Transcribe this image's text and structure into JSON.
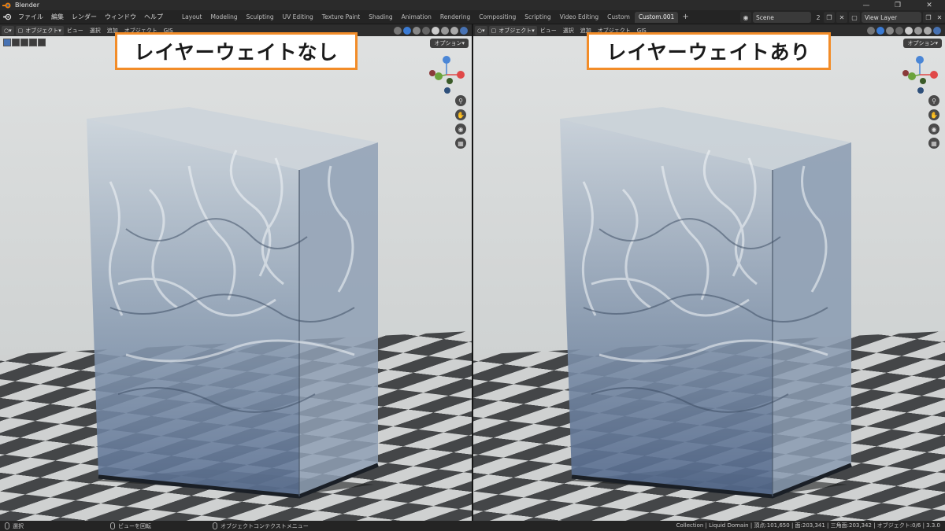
{
  "window": {
    "title": "Blender"
  },
  "menu": [
    "ファイル",
    "編集",
    "レンダー",
    "ウィンドウ",
    "ヘルプ"
  ],
  "workspaces": [
    "Layout",
    "Modeling",
    "Sculpting",
    "UV Editing",
    "Texture Paint",
    "Shading",
    "Animation",
    "Rendering",
    "Compositing",
    "Scripting",
    "Video Editing",
    "Custom",
    "Custom.001"
  ],
  "active_workspace": "Custom.001",
  "scene": {
    "name": "Scene",
    "count": "2"
  },
  "view_layer": {
    "name": "View Layer"
  },
  "viewport_left": {
    "mode": "オブジェクト",
    "menus": [
      "ビュー",
      "選択",
      "追加",
      "オブジェクト",
      "GIS"
    ],
    "options": "オプション",
    "label": "レイヤーウェイトなし"
  },
  "viewport_right": {
    "mode": "オブジェクト",
    "menus": [
      "ビュー",
      "選択",
      "追加",
      "オブジェクト",
      "GIS"
    ],
    "options": "オプション",
    "label": "レイヤーウェイトあり"
  },
  "gizmo": {
    "x": "X",
    "y": "Y",
    "z": "Z"
  },
  "status": {
    "select": "選択",
    "rotate": "ビューを回転",
    "context": "オブジェクトコンテクストメニュー",
    "stats": "Collection | Liquid Domain | 頂点:101,650 | 面:203,341 | 三角面:203,342 | オブジェクト:0/6 | 3.3.0"
  },
  "colors": {
    "label_border": "#f28c28",
    "accent": "#4772b3",
    "x_axis": "#e04848",
    "y_axis": "#6ba33c",
    "z_axis": "#4a86d6"
  }
}
